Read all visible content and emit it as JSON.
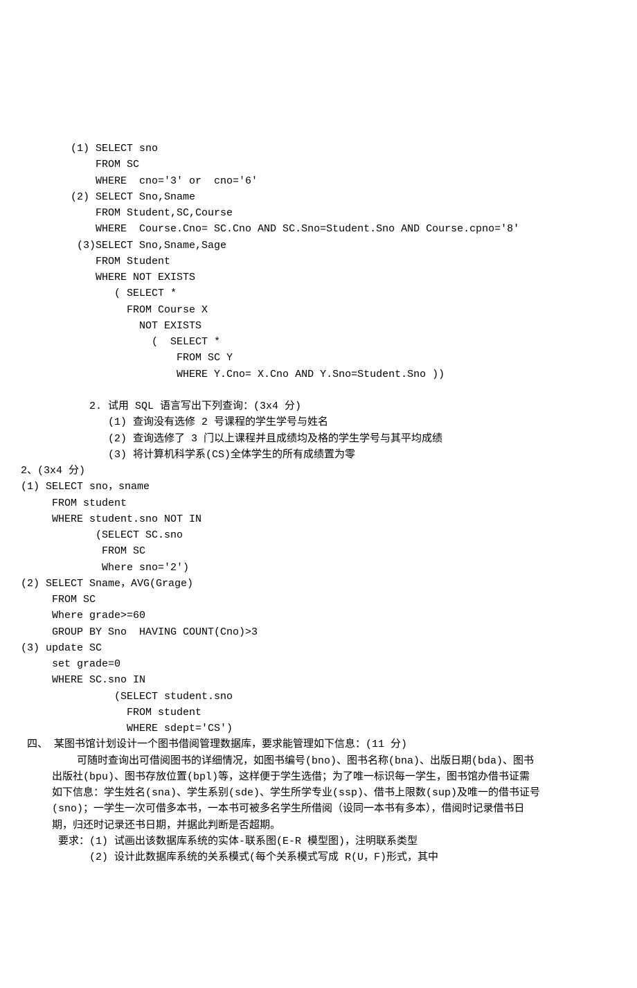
{
  "lines": [
    "        (1) SELECT sno",
    "            FROM SC",
    "            WHERE  cno='3' or  cno='6'",
    "        (2) SELECT Sno,Sname",
    "            FROM Student,SC,Course",
    "            WHERE  Course.Cno= SC.Cno AND SC.Sno=Student.Sno AND Course.cpno='8'",
    "         (3)SELECT Sno,Sname,Sage",
    "            FROM Student",
    "            WHERE NOT EXISTS",
    "               ( SELECT *",
    "                 FROM Course X",
    "                   NOT EXISTS",
    "                     (  SELECT *",
    "                         FROM SC Y",
    "                         WHERE Y.Cno= X.Cno AND Y.Sno=Student.Sno ))",
    "",
    "           2. 试用 SQL 语言写出下列查询：(3x4 分)",
    "              (1) 查询没有选修 2 号课程的学生学号与姓名",
    "              (2) 查询选修了 3 门以上课程并且成绩均及格的学生学号与其平均成绩",
    "              (3) 将计算机科学系(CS)全体学生的所有成绩置为零",
    "2、(3x4 分)",
    "(1) SELECT sno，sname",
    "     FROM student",
    "     WHERE student.sno NOT IN",
    "            (SELECT SC.sno",
    "             FROM SC",
    "             Where sno='2')",
    "(2) SELECT Sname，AVG(Grage)",
    "     FROM SC",
    "     Where grade>=60",
    "     GROUP BY Sno  HAVING COUNT(Cno)>3",
    "(3) update SC",
    "     set grade=0",
    "     WHERE SC.sno IN",
    "               (SELECT student.sno",
    "                 FROM student",
    "                 WHERE sdept='CS')",
    " 四、 某图书馆计划设计一个图书借阅管理数据库，要求能管理如下信息：(11 分)",
    "         可随时查询出可借阅图书的详细情况，如图书编号(bno)、图书名称(bna)、出版日期(bda)、图书",
    "     出版社(bpu)、图书存放位置(bpl)等，这样便于学生选借；为了唯一标识每一学生，图书馆办借书证需",
    "     如下信息：学生姓名(sna)、学生系别(sde)、学生所学专业(ssp)、借书上限数(sup)及唯一的借书证号",
    "     (sno)；一学生一次可借多本书，一本书可被多名学生所借阅（设同一本书有多本），借阅时记录借书日",
    "     期，归还时记录还书日期，并据此判断是否超期。",
    "      要求：(1) 试画出该数据库系统的实体-联系图(E-R 模型图)，注明联系类型",
    "           (2) 设计此数据库系统的关系模式(每个关系模式写成 R(U，F)形式，其中"
  ]
}
